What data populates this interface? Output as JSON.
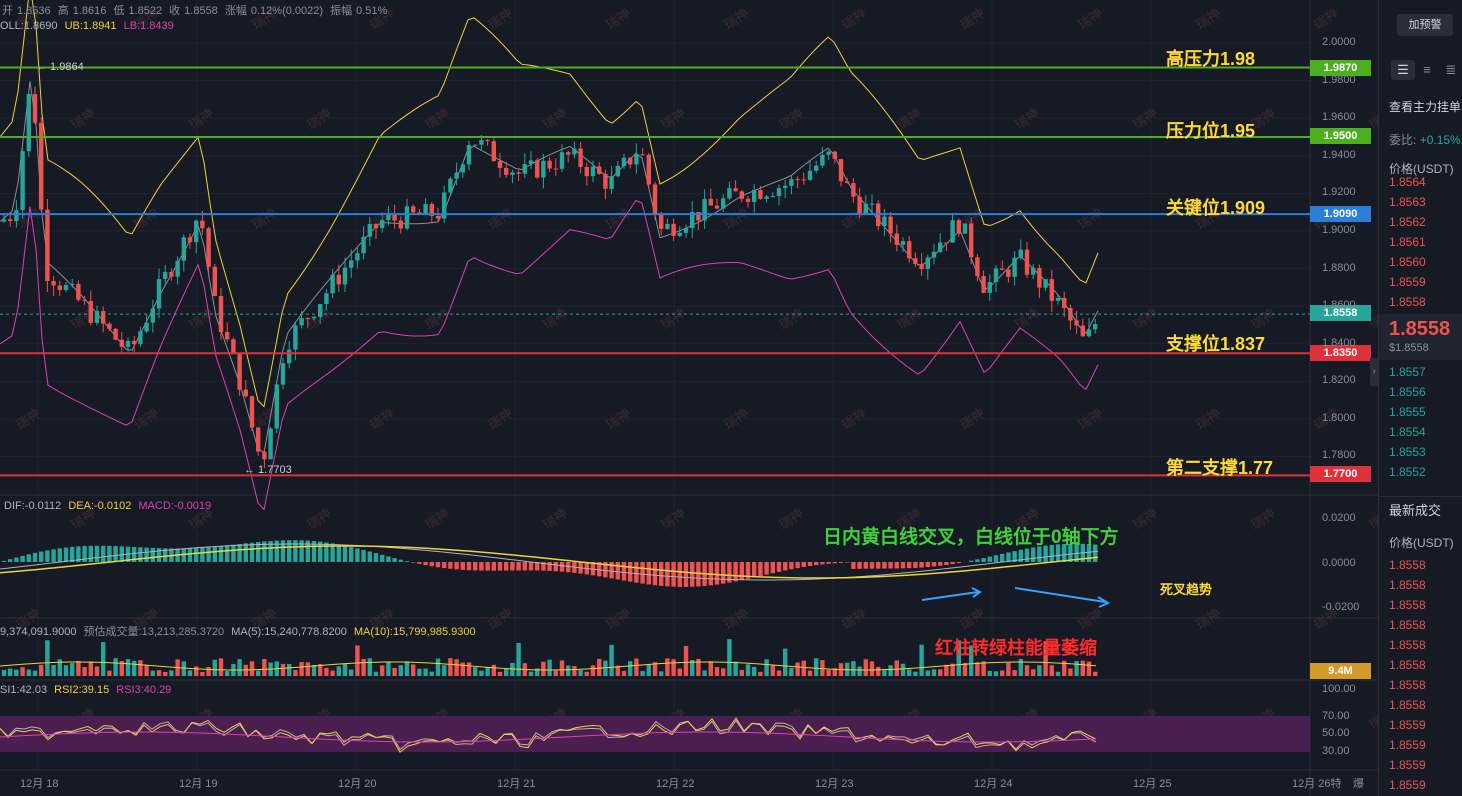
{
  "header": {
    "ohlc": [
      {
        "label": "开",
        "value": "1.8536"
      },
      {
        "label": "高",
        "value": "1.8616"
      },
      {
        "label": "低",
        "value": "1.8522"
      },
      {
        "label": "收",
        "value": "1.8558"
      },
      {
        "label": "涨幅",
        "value": "0.12%(0.0022)"
      },
      {
        "label": "振幅",
        "value": "0.51%"
      }
    ],
    "boll": {
      "mid": "OLL:1.8690",
      "ub": "UB:1.8941",
      "lb": "LB:1.8439"
    }
  },
  "price_axis": [
    "2.0000",
    "1.9800",
    "1.9600",
    "1.9400",
    "1.9200",
    "1.9000",
    "1.8800",
    "1.8600",
    "1.8400",
    "1.8200",
    "1.8000",
    "1.7800"
  ],
  "levels": [
    {
      "label": "高压力1.98",
      "tag": "1.9870",
      "color": "#4caf20",
      "price": 1.987
    },
    {
      "label": "压力位1.95",
      "tag": "1.9500",
      "color": "#4caf20",
      "price": 1.95
    },
    {
      "label": "关键位1.909",
      "tag": "1.9090",
      "color": "#2a7fd6",
      "price": 1.909
    },
    {
      "label": "支撑位1.837",
      "tag": "1.8350",
      "color": "#e0303a",
      "price": 1.835
    },
    {
      "label": "第二支撑1.77",
      "tag": "1.7700",
      "color": "#e0303a",
      "price": 1.77
    }
  ],
  "current_price": {
    "tag": "1.8558",
    "price": 1.8558
  },
  "high_marker": "← 1.9864",
  "low_marker": "← 1.7703",
  "macd": {
    "dif": "DIF:-0.0112",
    "dea": "DEA:-0.0102",
    "macd": "MACD:-0.0019",
    "axis": [
      "0.0200",
      "0.0000",
      "-0.0200"
    ]
  },
  "volume": {
    "text1": "9,374,091.9000",
    "text2": "预估成交量:13,213,285.3720",
    "ma5": "MA(5):15,240,778.8200",
    "ma10": "MA(10):15,799,985.9300",
    "tag": "9.4M"
  },
  "rsi": {
    "rsi1": "SI1:42.03",
    "rsi2": "RSI2:39.15",
    "rsi3": "RSI3:40.29",
    "axis": [
      "100.00",
      "70.00",
      "50.00",
      "30.00"
    ]
  },
  "x_axis": [
    "12月 18",
    "12月 19",
    "12月 20",
    "12月 21",
    "12月 22",
    "12月 23",
    "12月 24",
    "12月 25",
    "12月 26特",
    "爆"
  ],
  "annotations": {
    "macd_note": "日内黄白线交叉，白线位于0轴下方",
    "dead_cross": "死叉趋势",
    "volume_note": "红柱转绿柱能量萎缩"
  },
  "watermark": "瑞神",
  "sidebar": {
    "alert_button": "加预警",
    "title": "查看主力挂单",
    "ratio_label": "委比:",
    "ratio_value": "+0.15%",
    "price_header": "价格(USDT)",
    "asks": [
      "1.8564",
      "1.8563",
      "1.8562",
      "1.8561",
      "1.8560",
      "1.8559",
      "1.8558"
    ],
    "current": "1.8558",
    "current_sub": "$1.8558",
    "bids": [
      "1.8557",
      "1.8556",
      "1.8555",
      "1.8554",
      "1.8553",
      "1.8552"
    ],
    "trades_title": "最新成交",
    "trades_header": "价格(USDT)",
    "trades": [
      "1.8558",
      "1.8558",
      "1.8558",
      "1.8558",
      "1.8558",
      "1.8558",
      "1.8558",
      "1.8558",
      "1.8559",
      "1.8559",
      "1.8559",
      "1.8559"
    ],
    "colors": {
      "up": "#26a69a",
      "down": "#ef5350"
    }
  }
}
